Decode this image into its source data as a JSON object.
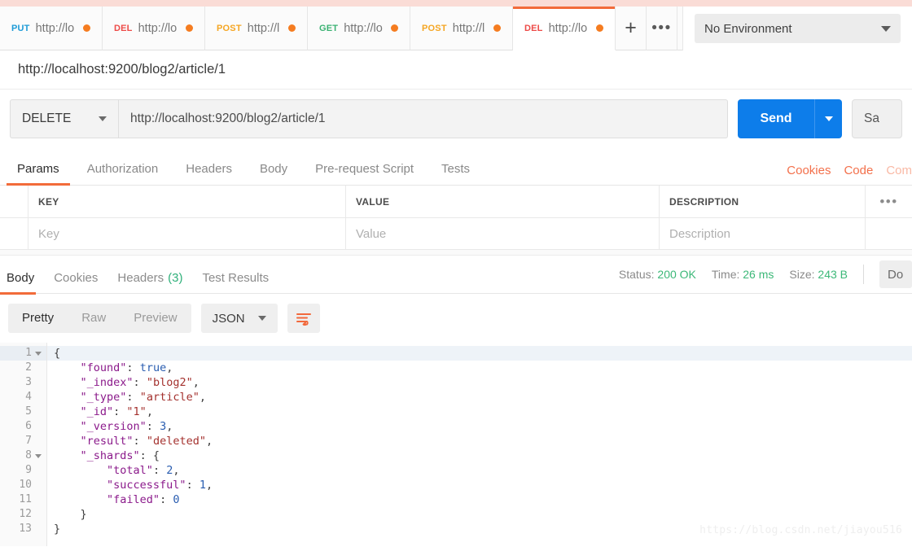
{
  "app": {
    "watermark": "https://blog.csdn.net/jiayou516"
  },
  "tabbar": {
    "tabs": [
      {
        "method": "PUT",
        "method_class": "m-put",
        "url": "http://lo",
        "unsaved": true,
        "active": false
      },
      {
        "method": "DEL",
        "method_class": "m-del",
        "url": "http://lo",
        "unsaved": true,
        "active": false
      },
      {
        "method": "POST",
        "method_class": "m-post",
        "url": "http://l",
        "unsaved": true,
        "active": false
      },
      {
        "method": "GET",
        "method_class": "m-get",
        "url": "http://lo",
        "unsaved": true,
        "active": false
      },
      {
        "method": "POST",
        "method_class": "m-post",
        "url": "http://l",
        "unsaved": true,
        "active": false
      },
      {
        "method": "DEL",
        "method_class": "m-del",
        "url": "http://lo",
        "unsaved": true,
        "active": true
      }
    ],
    "new_tab_label": "+",
    "more_label": "•••"
  },
  "environment": {
    "selected": "No Environment"
  },
  "request": {
    "title": "http://localhost:9200/blog2/article/1",
    "method": "DELETE",
    "url": "http://localhost:9200/blog2/article/1",
    "send_label": "Send",
    "save_label": "Sa",
    "tabs": [
      {
        "label": "Params",
        "active": true
      },
      {
        "label": "Authorization",
        "active": false
      },
      {
        "label": "Headers",
        "active": false
      },
      {
        "label": "Body",
        "active": false
      },
      {
        "label": "Pre-request Script",
        "active": false
      },
      {
        "label": "Tests",
        "active": false
      }
    ],
    "right_links": [
      {
        "label": "Cookies",
        "faded": false
      },
      {
        "label": "Code",
        "faded": false
      },
      {
        "label": "Com",
        "faded": true
      }
    ]
  },
  "params_table": {
    "headers": {
      "key": "KEY",
      "value": "VALUE",
      "description": "DESCRIPTION",
      "menu": "•••"
    },
    "placeholder_row": {
      "key": "Key",
      "value": "Value",
      "description": "Description"
    }
  },
  "response": {
    "tabs": [
      {
        "label": "Body",
        "badge": "",
        "active": true
      },
      {
        "label": "Cookies",
        "badge": "",
        "active": false
      },
      {
        "label": "Headers",
        "badge": "(3)",
        "active": false
      },
      {
        "label": "Test Results",
        "badge": "",
        "active": false
      }
    ],
    "meta": {
      "status_label": "Status:",
      "status_value": "200 OK",
      "time_label": "Time:",
      "time_value": "26 ms",
      "size_label": "Size:",
      "size_value": "243 B"
    },
    "download_label": "Do",
    "format_modes": [
      {
        "label": "Pretty",
        "active": true
      },
      {
        "label": "Raw",
        "active": false
      },
      {
        "label": "Preview",
        "active": false
      }
    ],
    "format_type": "JSON",
    "body_lines": [
      {
        "n": 1,
        "foldable": true,
        "indent": 0,
        "tokens": [
          {
            "t": "{",
            "c": "k-punc"
          }
        ]
      },
      {
        "n": 2,
        "foldable": false,
        "indent": 1,
        "tokens": [
          {
            "t": "\"found\"",
            "c": "k-key"
          },
          {
            "t": ": ",
            "c": "k-punc"
          },
          {
            "t": "true",
            "c": "k-bool"
          },
          {
            "t": ",",
            "c": "k-punc"
          }
        ]
      },
      {
        "n": 3,
        "foldable": false,
        "indent": 1,
        "tokens": [
          {
            "t": "\"_index\"",
            "c": "k-key"
          },
          {
            "t": ": ",
            "c": "k-punc"
          },
          {
            "t": "\"blog2\"",
            "c": "k-str"
          },
          {
            "t": ",",
            "c": "k-punc"
          }
        ]
      },
      {
        "n": 4,
        "foldable": false,
        "indent": 1,
        "tokens": [
          {
            "t": "\"_type\"",
            "c": "k-key"
          },
          {
            "t": ": ",
            "c": "k-punc"
          },
          {
            "t": "\"article\"",
            "c": "k-str"
          },
          {
            "t": ",",
            "c": "k-punc"
          }
        ]
      },
      {
        "n": 5,
        "foldable": false,
        "indent": 1,
        "tokens": [
          {
            "t": "\"_id\"",
            "c": "k-key"
          },
          {
            "t": ": ",
            "c": "k-punc"
          },
          {
            "t": "\"1\"",
            "c": "k-str"
          },
          {
            "t": ",",
            "c": "k-punc"
          }
        ]
      },
      {
        "n": 6,
        "foldable": false,
        "indent": 1,
        "tokens": [
          {
            "t": "\"_version\"",
            "c": "k-key"
          },
          {
            "t": ": ",
            "c": "k-punc"
          },
          {
            "t": "3",
            "c": "k-num"
          },
          {
            "t": ",",
            "c": "k-punc"
          }
        ]
      },
      {
        "n": 7,
        "foldable": false,
        "indent": 1,
        "tokens": [
          {
            "t": "\"result\"",
            "c": "k-key"
          },
          {
            "t": ": ",
            "c": "k-punc"
          },
          {
            "t": "\"deleted\"",
            "c": "k-str"
          },
          {
            "t": ",",
            "c": "k-punc"
          }
        ]
      },
      {
        "n": 8,
        "foldable": true,
        "indent": 1,
        "tokens": [
          {
            "t": "\"_shards\"",
            "c": "k-key"
          },
          {
            "t": ": {",
            "c": "k-punc"
          }
        ]
      },
      {
        "n": 9,
        "foldable": false,
        "indent": 2,
        "tokens": [
          {
            "t": "\"total\"",
            "c": "k-key"
          },
          {
            "t": ": ",
            "c": "k-punc"
          },
          {
            "t": "2",
            "c": "k-num"
          },
          {
            "t": ",",
            "c": "k-punc"
          }
        ]
      },
      {
        "n": 10,
        "foldable": false,
        "indent": 2,
        "tokens": [
          {
            "t": "\"successful\"",
            "c": "k-key"
          },
          {
            "t": ": ",
            "c": "k-punc"
          },
          {
            "t": "1",
            "c": "k-num"
          },
          {
            "t": ",",
            "c": "k-punc"
          }
        ]
      },
      {
        "n": 11,
        "foldable": false,
        "indent": 2,
        "tokens": [
          {
            "t": "\"failed\"",
            "c": "k-key"
          },
          {
            "t": ": ",
            "c": "k-punc"
          },
          {
            "t": "0",
            "c": "k-num"
          }
        ]
      },
      {
        "n": 12,
        "foldable": false,
        "indent": 1,
        "tokens": [
          {
            "t": "}",
            "c": "k-punc"
          }
        ]
      },
      {
        "n": 13,
        "foldable": false,
        "indent": 0,
        "tokens": [
          {
            "t": "}",
            "c": "k-punc"
          }
        ]
      }
    ]
  }
}
